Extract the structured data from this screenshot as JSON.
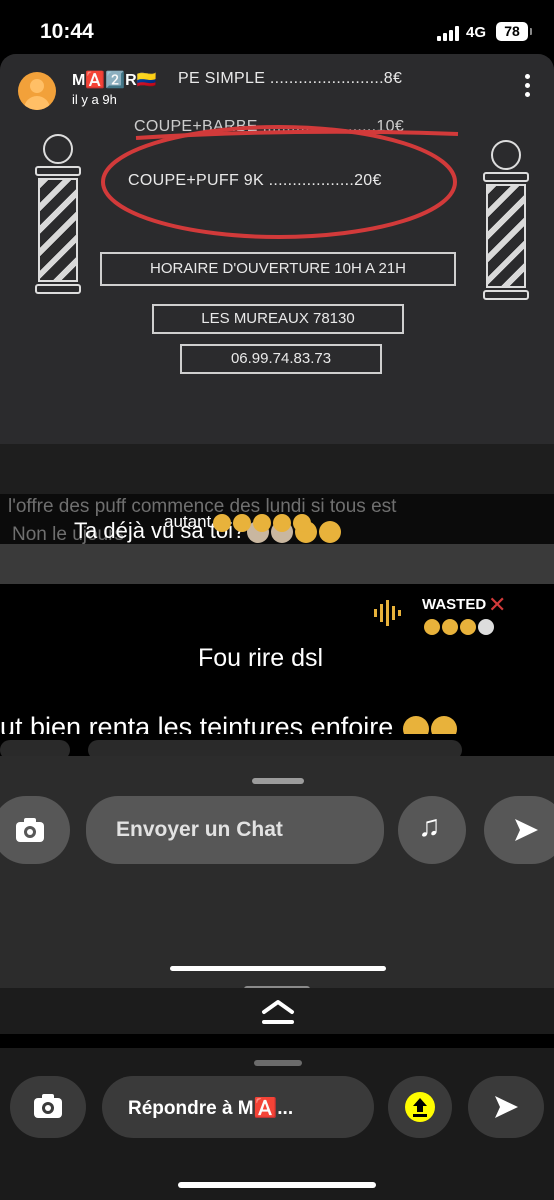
{
  "status_bar": {
    "time": "10:44",
    "network": "4G",
    "battery": "78"
  },
  "story": {
    "username": "M🅰️2️⃣R🇨🇴",
    "timestamp": "il y a 9h",
    "flyer": {
      "line1": "PE SIMPLE ........................8€",
      "line2": "COUPE+BARBE ........................10€",
      "line3": "COUPE+PUFF 9K ..................20€",
      "hours": "HORAIRE D'OUVERTURE 10H A 21H",
      "city": "LES MUREAUX 78130",
      "phone": "06.99.74.83.73"
    },
    "ghost_text_1": "l'offre des puff commence des lundi si tous est",
    "ghost_text_2": "Non le                                                      ujours",
    "caption_1": "Ta déjà vu sa toi?",
    "caption_2": "autant",
    "wasted": "WASTED",
    "caption_3": "Fou rire dsl",
    "caption_4": "ut bien renta les teintures enfoire",
    "inner_input_placeholder": "Envoyer un Chat"
  },
  "reply_bar": {
    "placeholder": "Répondre à M🅰️..."
  },
  "colors": {
    "accent_red": "#d23a3a",
    "snap_yellow": "#fffc00"
  }
}
